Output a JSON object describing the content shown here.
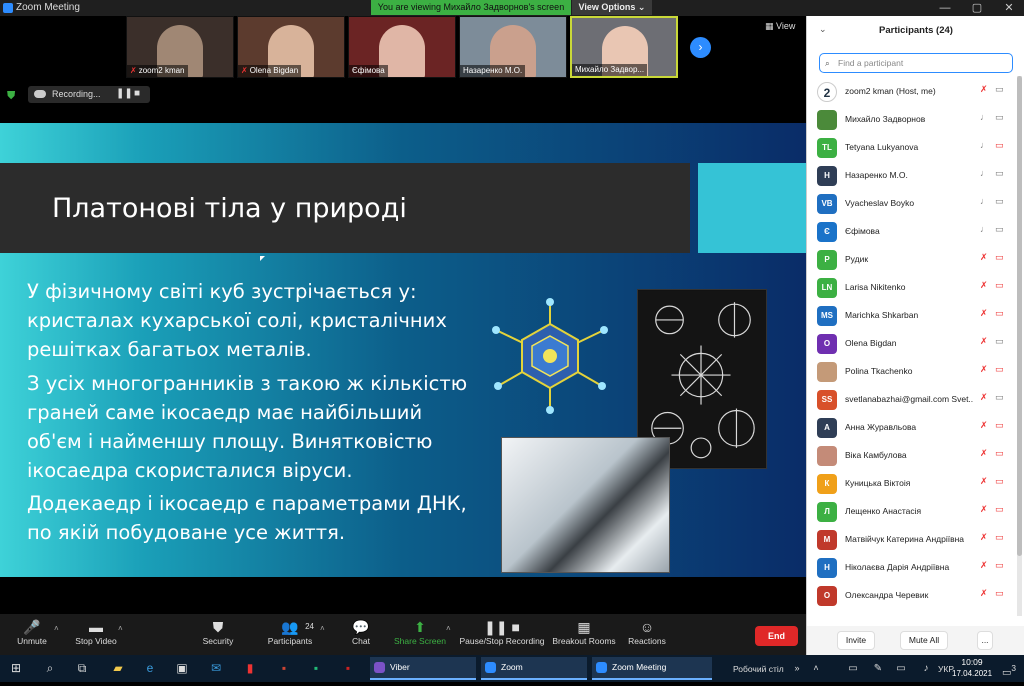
{
  "window": {
    "title": "Zoom Meeting",
    "banner": "You are viewing Михайло Задворнов's screen",
    "view_options": "View Options ⌄",
    "minimize": "—",
    "maximize": "▢",
    "close": "✕"
  },
  "gallery": {
    "thumbs": [
      {
        "name": "zoom2 kman",
        "muted": true,
        "bg": "#3b2f2a",
        "face": "#a08774"
      },
      {
        "name": "Olena Bigdan",
        "muted": true,
        "bg": "#5c3b2e",
        "face": "#d8b39a"
      },
      {
        "name": "Єфімова",
        "muted": false,
        "bg": "#6b2424",
        "face": "#e0b6a6"
      },
      {
        "name": "Назаренко М.О.",
        "muted": false,
        "bg": "#7d8c99",
        "face": "#caa08d"
      },
      {
        "name": "Михайло Задвор...",
        "muted": false,
        "bg": "#6d6e74",
        "face": "#e9c6b3"
      }
    ],
    "next_icon": "›",
    "view_label": "View"
  },
  "recording": {
    "label": "Recording...",
    "pause_icon": "❚❚",
    "stop_icon": "■",
    "shield_icon": "⛊"
  },
  "slide": {
    "title": "Платонові тіла у природі",
    "paragraphs": [
      "У фізичному світі куб зустрічається у:\nкристалах кухарської солі, кристалічних\nрешітках багатьох металів.",
      "З усіх многогранників з такою ж кількістю\nграней саме ікосаедр має найбільший\nоб'єм і найменшу площу. Винятковістю\nікосаедра скористалися віруси.",
      "Додекаедр і ікосаедр є параметрами ДНК,\nпо якій побудоване усе життя."
    ]
  },
  "toolbar": {
    "buttons": [
      {
        "key": "unmute",
        "label": "Unmute",
        "icon": "🎤",
        "caret": true
      },
      {
        "key": "stop-video",
        "label": "Stop Video",
        "icon": "▬",
        "caret": true
      },
      {
        "key": "security",
        "label": "Security",
        "icon": "⛊",
        "caret": false
      },
      {
        "key": "participants",
        "label": "Participants",
        "icon": "👥",
        "badge": "24",
        "caret": true
      },
      {
        "key": "chat",
        "label": "Chat",
        "icon": "💬",
        "caret": false
      },
      {
        "key": "share-screen",
        "label": "Share Screen",
        "icon": "⬆",
        "caret": true
      },
      {
        "key": "pause-stop-recording",
        "label": "Pause/Stop Recording",
        "icon": "❚❚ ■",
        "caret": false
      },
      {
        "key": "breakout-rooms",
        "label": "Breakout Rooms",
        "icon": "▦",
        "caret": false
      },
      {
        "key": "reactions",
        "label": "Reactions",
        "icon": "☺",
        "caret": false
      }
    ],
    "end_label": "End"
  },
  "participants": {
    "title": "Participants (24)",
    "chevron": "⌄",
    "search_placeholder": "Find a participant",
    "rows": [
      {
        "initials": "2",
        "name": "zoom2 kman (Host, me)",
        "color": "#ffffff",
        "mic_muted": true,
        "cam_off": false
      },
      {
        "initials": "",
        "name": "Михайло Задворнов",
        "color": "#4b8a3a",
        "mic_muted": false,
        "cam_off": false
      },
      {
        "initials": "TL",
        "name": "Tetyana Lukyanova",
        "color": "#3cb043",
        "mic_muted": false,
        "cam_off": true
      },
      {
        "initials": "Н",
        "name": "Назаренко М.О.",
        "color": "#2f3e56",
        "mic_muted": false,
        "cam_off": false
      },
      {
        "initials": "VB",
        "name": "Vyacheslav Boyko",
        "color": "#1f6fc1",
        "mic_muted": false,
        "cam_off": false
      },
      {
        "initials": "Є",
        "name": "Єфімова",
        "color": "#1a73c9",
        "mic_muted": false,
        "cam_off": false
      },
      {
        "initials": "Р",
        "name": " Рудик",
        "color": "#3cb043",
        "mic_muted": true,
        "cam_off": true
      },
      {
        "initials": "LN",
        "name": "Larisa Nikitenko",
        "color": "#3cb043",
        "mic_muted": true,
        "cam_off": true
      },
      {
        "initials": "MS",
        "name": "Marichka Shkarban",
        "color": "#1f6fc1",
        "mic_muted": true,
        "cam_off": true
      },
      {
        "initials": "O",
        "name": "Olena Bigdan",
        "color": "#6f2fb0",
        "mic_muted": true,
        "cam_off": false
      },
      {
        "initials": "",
        "name": "Polina Tkachenko",
        "color": "#c49a78",
        "mic_muted": true,
        "cam_off": true
      },
      {
        "initials": "SS",
        "name": "svetlanabazhai@gmail.com Svet...",
        "color": "#d8502a",
        "mic_muted": true,
        "cam_off": false
      },
      {
        "initials": "А",
        "name": "Анна Журавльова",
        "color": "#2f3e56",
        "mic_muted": true,
        "cam_off": true
      },
      {
        "initials": "",
        "name": "Віка Камбулова",
        "color": "#c48b78",
        "mic_muted": true,
        "cam_off": true
      },
      {
        "initials": "К",
        "name": "Куницька Віктоія",
        "color": "#f0a019",
        "mic_muted": true,
        "cam_off": true
      },
      {
        "initials": "Л",
        "name": "Лещенко Анастасія",
        "color": "#3cb043",
        "mic_muted": true,
        "cam_off": true
      },
      {
        "initials": "М",
        "name": "Матвійчук Катерина Андріївна",
        "color": "#c0392b",
        "mic_muted": true,
        "cam_off": true
      },
      {
        "initials": "Н",
        "name": "Ніколаєва Дарія Андріївна",
        "color": "#1f6fc1",
        "mic_muted": true,
        "cam_off": true
      },
      {
        "initials": "О",
        "name": "Олександра Черевик",
        "color": "#c0392b",
        "mic_muted": true,
        "cam_off": true
      }
    ],
    "invite_label": "Invite",
    "mute_all_label": "Mute All",
    "more_label": "..."
  },
  "taskbar": {
    "apps": [
      {
        "label": "Viber",
        "color": "#7b52c7"
      },
      {
        "label": "Zoom",
        "color": "#2d8cff"
      },
      {
        "label": "Zoom Meeting",
        "color": "#2d8cff"
      }
    ],
    "desktop_label": "Робочий стіл",
    "lang": "УКР",
    "time": "10:09",
    "date": "17.04.2021",
    "notif_count": "3"
  }
}
